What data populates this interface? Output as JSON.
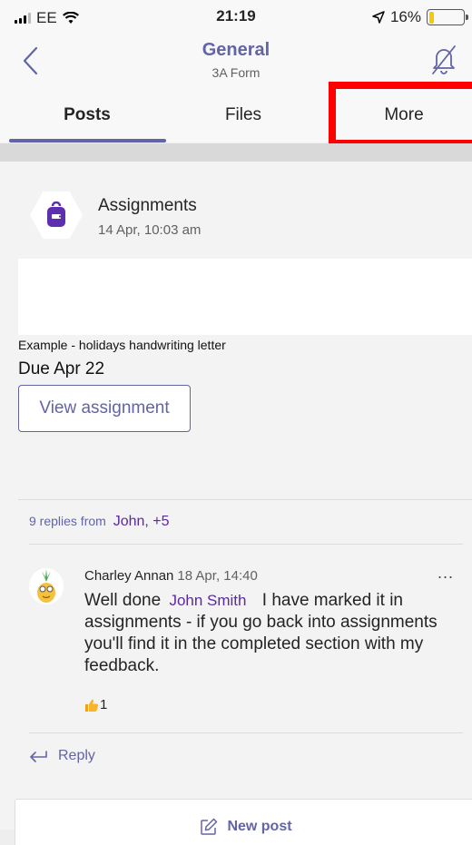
{
  "status_bar": {
    "carrier": "EE",
    "time": "21:19",
    "battery_percent": "16%",
    "battery_level": 0.16,
    "icons": [
      "signal-icon",
      "wifi-icon",
      "location-arrow-icon",
      "battery-icon"
    ]
  },
  "header": {
    "title": "General",
    "subtitle": "3A Form",
    "icons": [
      "back-chevron-icon",
      "bell-off-icon"
    ]
  },
  "tabs": [
    {
      "label": "Posts",
      "active": true
    },
    {
      "label": "Files",
      "active": false
    },
    {
      "label": "More",
      "active": false
    }
  ],
  "post": {
    "app_name": "Assignments",
    "timestamp": "14 Apr, 10:03 am",
    "assignment_title": "Example - holidays handwriting letter",
    "due": "Due Apr 22",
    "view_button": "View assignment",
    "replies_summary": "9 replies from",
    "replies_names": "John, +5",
    "reply": {
      "author": "Charley Annan",
      "time": "18 Apr, 14:40",
      "more": "...",
      "text_before": "Well done",
      "mention": "John Smith",
      "text_after": "I have marked it in assignments - if you go back into assignments you'll find it in the completed section with my feedback.",
      "reaction_count": "1"
    },
    "reply_link": "Reply"
  },
  "compose": {
    "new_post_label": "New post"
  },
  "colors": {
    "accent": "#6264a7",
    "mention": "#5b2a9b",
    "battery": "#f7c900",
    "highlight": "#ff0000"
  }
}
